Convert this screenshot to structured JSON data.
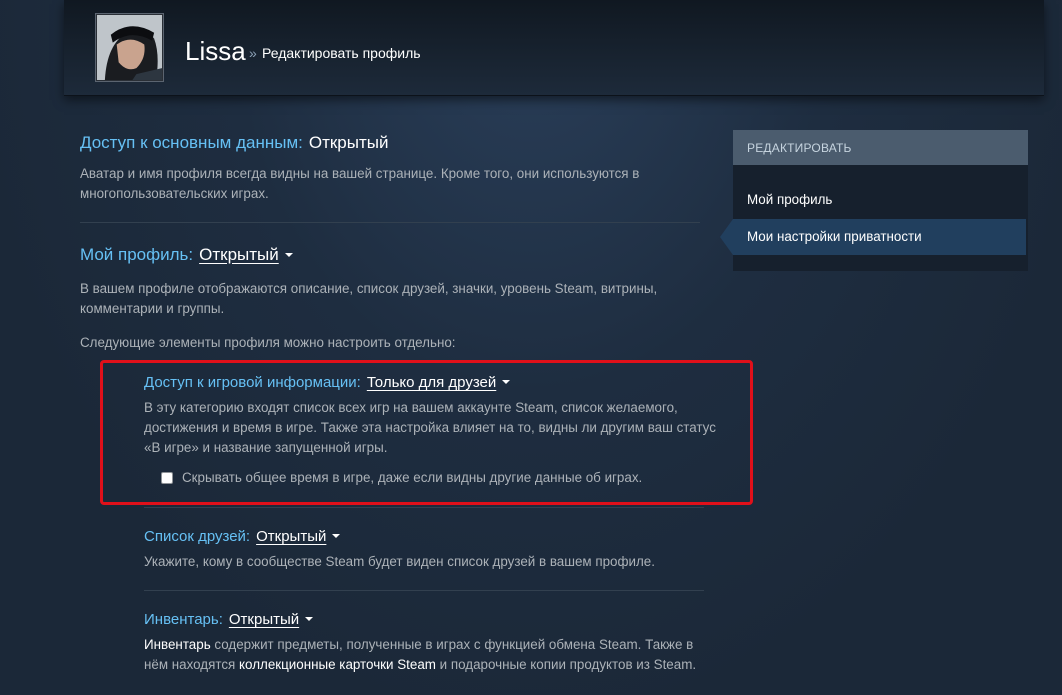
{
  "header": {
    "name": "Lissa",
    "separator": "»",
    "subtitle": "Редактировать профиль"
  },
  "basic": {
    "label": "Доступ к основным данным:",
    "value": "Открытый",
    "description": "Аватар и имя профиля всегда видны на вашей странице. Кроме того, они используются в многопользовательских играх."
  },
  "profile": {
    "label": "Мой профиль:",
    "value": "Открытый",
    "description": "В вашем профиле отображаются описание, список друзей, значки, уровень Steam, витрины, комментарии и группы.",
    "note": "Следующие элементы профиля можно настроить отдельно:"
  },
  "game_details": {
    "label": "Доступ к игровой информации:",
    "value": "Только для друзей",
    "description": "В эту категорию входят список всех игр на вашем аккаунте Steam, список желаемого, достижения и время в игре. Также эта настройка влияет на то, видны ли другим ваш статус «В игре» и название запущенной игры.",
    "checkbox_label": "Скрывать общее время в игре, даже если видны другие данные об играх.",
    "checkbox_checked": false
  },
  "friends": {
    "label": "Список друзей:",
    "value": "Открытый",
    "description": "Укажите, кому в сообществе Steam будет виден список друзей в вашем профиле."
  },
  "inventory": {
    "label": "Инвентарь:",
    "value": "Открытый",
    "desc_bold1": "Инвентарь",
    "desc_part1": " содержит предметы, полученные в играх с функцией обмена Steam. Также в нём находятся ",
    "desc_bold2": "коллекционные карточки Steam",
    "desc_part2": " и подарочные копии продуктов из Steam."
  },
  "sidebar": {
    "heading": "РЕДАКТИРОВАТЬ",
    "items": [
      {
        "label": "Мой профиль",
        "active": false
      },
      {
        "label": "Мои настройки приватности",
        "active": true
      }
    ]
  },
  "colors": {
    "background": "#1b2838",
    "accent_blue": "#66c0f4",
    "highlight_box": "#e0101a"
  }
}
